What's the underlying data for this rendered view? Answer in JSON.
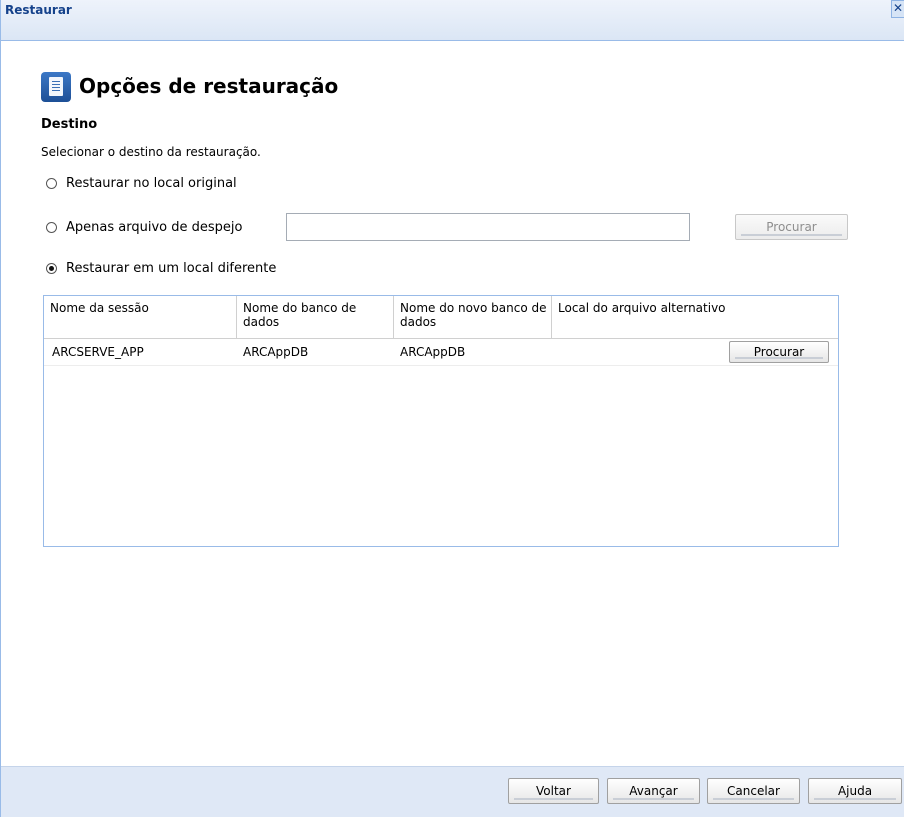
{
  "window": {
    "title": "Restaurar",
    "close_symbol": "✕"
  },
  "header": {
    "icon": "document-list-icon",
    "title": "Opções de restauração"
  },
  "destination": {
    "section_label": "Destino",
    "instruction": "Selecionar o destino da restauração.",
    "options": [
      {
        "label": "Restaurar no local original",
        "checked": false
      },
      {
        "label": "Apenas arquivo de despejo",
        "checked": false
      },
      {
        "label": "Restaurar em um local diferente",
        "checked": true
      }
    ],
    "dump_file_value": "",
    "browse_label": "Procurar"
  },
  "table": {
    "columns": [
      "Nome da sessão",
      "Nome do banco de dados",
      "Nome do novo banco de dados",
      "Local do arquivo alternativo"
    ],
    "rows": [
      {
        "session": "ARCSERVE_APP",
        "database": "ARCAppDB",
        "new_database": "ARCAppDB",
        "alt_location": "",
        "browse_label": "Procurar"
      }
    ]
  },
  "footer": {
    "back": "Voltar",
    "next": "Avançar",
    "cancel": "Cancelar",
    "help": "Ajuda"
  },
  "colors": {
    "accent": "#15428b",
    "border": "#99bbe8",
    "footer_bg": "#dfe8f6"
  }
}
